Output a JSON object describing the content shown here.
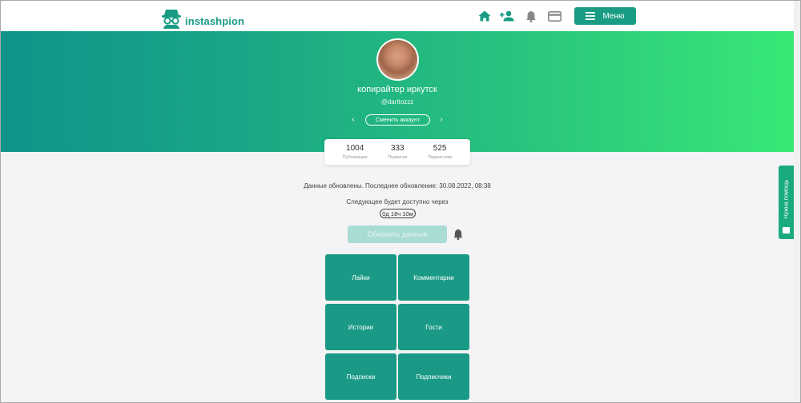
{
  "header": {
    "brand": "instashpion",
    "menu_label": "Меню"
  },
  "profile": {
    "name": "копирайтер иркутск",
    "handle": "@darttozzz",
    "switch_label": "Сменить аккаунт",
    "stats": [
      {
        "value": "1004",
        "label": "Публикации"
      },
      {
        "value": "333",
        "label": "Подписки"
      },
      {
        "value": "525",
        "label": "Подписчики"
      }
    ]
  },
  "status": {
    "updated_text": "Данные обновлены. Последнее обновление: 30.08.2022, 08:38",
    "next_text": "Следующее будет доступно через",
    "timer": "0д 18ч 10м",
    "refresh_label": "Обновить данные"
  },
  "tiles": [
    {
      "label": "Лайки"
    },
    {
      "label": "Комментарии"
    },
    {
      "label": "Истории"
    },
    {
      "label": "Гости"
    },
    {
      "label": "Подписки"
    },
    {
      "label": "Подписчики"
    }
  ],
  "help": {
    "label": "Нужна помощь"
  },
  "icons": {
    "nav": [
      "home-icon",
      "add-user-icon",
      "bell-icon",
      "card-icon"
    ],
    "menu": "hamburger-icon",
    "logo": "spy-icon"
  },
  "colors": {
    "brand": "#1a9c84",
    "gradient_start": "#10948a",
    "gradient_end": "#39e876",
    "tile": "#1a9a86",
    "refresh_disabled": "#a8dcd5"
  }
}
